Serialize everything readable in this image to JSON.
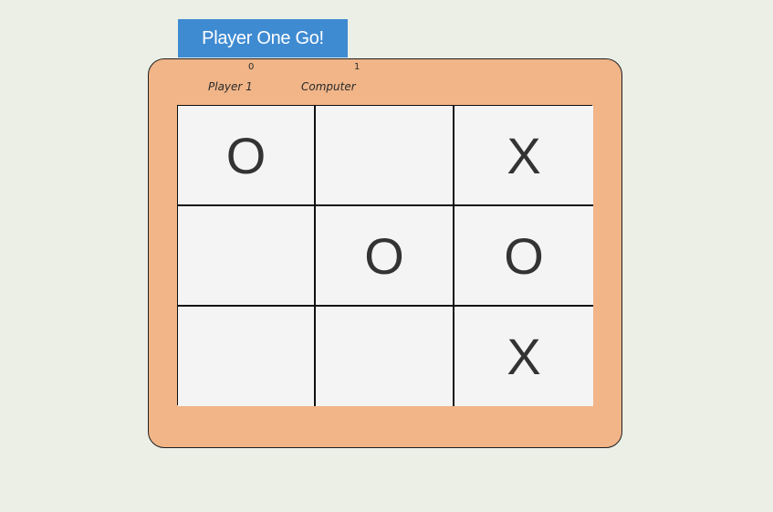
{
  "banner": {
    "label": "Player One Go!"
  },
  "scoreboard": {
    "player1": {
      "label": "Player 1",
      "score": "0"
    },
    "computer": {
      "label": "Computer",
      "score": "1"
    }
  },
  "board": {
    "cells": [
      "O",
      "",
      "X",
      "",
      "O",
      "O",
      "",
      "",
      "X"
    ]
  },
  "colors": {
    "background": "#ebefe6",
    "banner": "#3f8bd2",
    "frame": "#f1b588",
    "cell": "#f4f4f4",
    "mark": "#333333"
  }
}
